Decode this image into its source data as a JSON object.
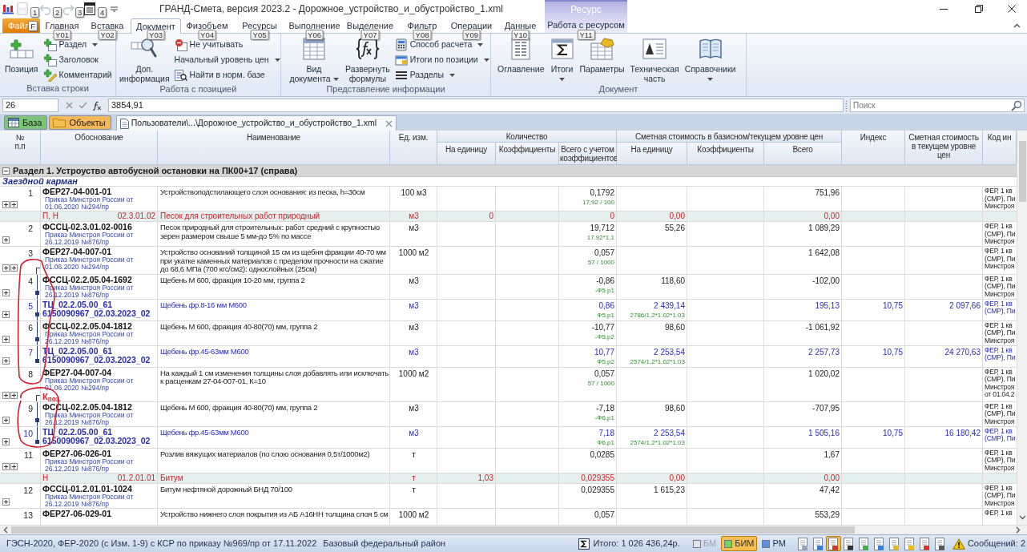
{
  "title_bar": {
    "title": "ГРАНД-Смета, версия 2023.2 - Дорожное_устройство_и_обустройство_1.xml",
    "quick_access": [
      {
        "keytip": "1",
        "disabled": true
      },
      {
        "keytip": "2",
        "disabled": true
      },
      {
        "keytip": "3",
        "disabled": true
      },
      {
        "keytip": "4",
        "disabled": false
      }
    ]
  },
  "ribbon": {
    "tabs": [
      {
        "kind": "file",
        "label": "Файл",
        "keytip": "F",
        "selected": false
      },
      {
        "kind": "normal",
        "label": "Главная",
        "keytip": "Y01",
        "selected": false
      },
      {
        "kind": "normal",
        "label": "Вставка",
        "keytip": "Y02",
        "selected": false
      },
      {
        "kind": "normal",
        "label": "Документ",
        "keytip": "Y03",
        "selected": true
      },
      {
        "kind": "normal",
        "label": "Физобъем",
        "keytip": "Y04",
        "selected": false
      },
      {
        "kind": "normal",
        "label": "Ресурсы",
        "keytip": "Y05",
        "selected": false
      },
      {
        "kind": "normal",
        "label": "Выполнение",
        "keytip": "Y06",
        "selected": false
      },
      {
        "kind": "normal",
        "label": "Выделение",
        "keytip": "Y07",
        "selected": false
      },
      {
        "kind": "normal",
        "label": "Фильтр",
        "keytip": "Y08",
        "selected": false
      },
      {
        "kind": "normal",
        "label": "Операции",
        "keytip": "Y09",
        "selected": false
      },
      {
        "kind": "normal",
        "label": "Данные",
        "keytip": "Y10",
        "selected": false
      },
      {
        "kind": "contextual",
        "label": "Работа с ресурсом",
        "keytip": "Y11",
        "selected": false
      }
    ],
    "contextual_group": "Ресурс",
    "groups": [
      {
        "label": "Вставка строки",
        "buttons": [
          {
            "kind": "large",
            "label": "Позиция",
            "dropdown": false
          },
          {
            "kind": "small",
            "label": "Раздел",
            "dropdown": true
          },
          {
            "kind": "small",
            "label": "Заголовок",
            "dropdown": false
          },
          {
            "kind": "small",
            "label": "Комментарий",
            "dropdown": false
          }
        ]
      },
      {
        "label": "Работа с позицией",
        "buttons": [
          {
            "kind": "large",
            "label": "Доп. информация",
            "dropdown": false
          },
          {
            "kind": "small",
            "label": "Не учитывать",
            "dropdown": false
          },
          {
            "kind": "small",
            "label": "Начальный уровень цен",
            "dropdown": true
          },
          {
            "kind": "small",
            "label": "Найти в норм. базе",
            "dropdown": false
          }
        ]
      },
      {
        "label": "Представление информации",
        "buttons": [
          {
            "kind": "large",
            "label": "Вид документа",
            "dropdown": true
          },
          {
            "kind": "large",
            "label": "Развернуть формулы",
            "dropdown": false
          },
          {
            "kind": "small",
            "label": "Способ расчета",
            "dropdown": true
          },
          {
            "kind": "small",
            "label": "Итоги по позиции",
            "dropdown": true
          },
          {
            "kind": "small",
            "label": "Разделы",
            "dropdown": true
          }
        ]
      },
      {
        "label": "Документ",
        "buttons": [
          {
            "kind": "large",
            "label": "Оглавление",
            "dropdown": false
          },
          {
            "kind": "large",
            "label": "Итоги",
            "dropdown": true
          },
          {
            "kind": "large",
            "label": "Параметры",
            "dropdown": false
          },
          {
            "kind": "large",
            "label": "Техническая часть",
            "dropdown": false
          },
          {
            "kind": "large",
            "label": "Справочники",
            "dropdown": true
          }
        ]
      }
    ]
  },
  "formula_bar": {
    "cell": "26",
    "value": "3854,91",
    "search_placeholder": "Поиск"
  },
  "document_tabs": {
    "buttons": [
      {
        "label": "База",
        "color": "#7cc47a"
      },
      {
        "label": "Объекты",
        "color": "#f6b65a"
      }
    ],
    "file_tab": "Пользователи\\...\\Дорожное_устройство_и_обустройство_1.xml"
  },
  "table": {
    "columns": [
      {
        "label": "№ п.п"
      },
      {
        "label": "Обоснование"
      },
      {
        "label": "Наименование"
      },
      {
        "label": "Ед. изм."
      },
      {
        "label": "Количество",
        "children": [
          "На единицу",
          "Коэффициенты",
          "Всего с учетом коэффициентов"
        ]
      },
      {
        "label": "Сметная стоимость в базисном/текущем уровне цен",
        "children": [
          "На единицу",
          "Коэффициенты",
          "Всего"
        ]
      },
      {
        "label": "Индекс"
      },
      {
        "label": "Сметная стоимость в текущем уровне цен"
      },
      {
        "label": "Код ин"
      }
    ],
    "section": {
      "title": "Раздел 1. Устроуство автобусной остановки на ПК00+17 (справа)",
      "expanded": true
    },
    "subsection": "Заездной карман",
    "rows": [
      {
        "kind": "position",
        "number": "1",
        "code": "ФЕР27-04-001-01",
        "order": "Приказ Минстроя России от 01.06.2020 №294/пр",
        "name": "Устройствоподстилающего слоя основания: из песка, h=30см",
        "unit": "100 м3",
        "quantity": "0,1792",
        "quantity_formula": "17,92 / 100",
        "total": "751,96",
        "code_info": [
          "ФЕР, 1 кв",
          "(СМР), Пи",
          "Минстроя"
        ],
        "expanders": [
          {
            "expanded": false
          },
          {
            "expanded": false
          }
        ],
        "linked_to_previous": false,
        "linked_to_next": false
      },
      {
        "kind": "resource",
        "type_code": "П, Н",
        "code": "02.3.01.02",
        "name": "Песок для строительных работ природный",
        "unit": "м3",
        "per_unit": "0",
        "quantity": "0",
        "unit_price": "0,00",
        "total": "0,00"
      },
      {
        "kind": "position",
        "number": "2",
        "code": "ФССЦ-02.3.01.02-0016",
        "order": "Приказ Минстроя России от 26.12.2019 №876/пр",
        "name": "Песок природный для строительных: работ средний с крупностью зерен размером свыше 5 мм-до 5% по массе",
        "unit": "м3",
        "quantity": "19,712",
        "quantity_formula": "17.92*1,1",
        "unit_price": "55,26",
        "total": "1 089,29",
        "code_info": [
          "ФЕР, 1 кв",
          "(СМР), Пи",
          "Минстроя"
        ],
        "expanders": [
          {
            "expanded": false
          }
        ],
        "linked_to_previous": false,
        "linked_to_next": false
      },
      {
        "kind": "position",
        "number": "3",
        "code": "ФЕР27-04-007-01",
        "order": "Приказ Минстроя России от 01.06.2020 №294/пр",
        "name": "Устройство оснований толщиной 15 см из щебня фракции 40-70 мм при укатке каменных материалов с пределом прочности на сжатие до 68,6 МПа (700 кгс/см2): однослойных (25см)",
        "unit": "1000 м2",
        "quantity": "0,057",
        "quantity_formula": "57 / 1000",
        "total": "1 642,08",
        "code_info": [
          "ФЕР, 1 кв",
          "(СМР), Пи",
          "Минстроя"
        ],
        "expanders": [
          {
            "expanded": false
          },
          {
            "expanded": false
          }
        ],
        "linked_to_previous": false,
        "linked_to_next": true
      },
      {
        "kind": "position",
        "number": "4",
        "code": "ФССЦ-02.2.05.04-1692",
        "order": "Приказ Минстроя России от 26.12.2019 №876/пр",
        "name": "Щебень М 600, фракция 10-20 мм, группа 2",
        "unit": "м3",
        "quantity": "-0,86",
        "quantity_formula": "-Ф5.р1",
        "unit_price": "118,60",
        "total": "-102,00",
        "code_info": [
          "ФЕР, 1 кв",
          "(СМР), Пи",
          "Минстроя"
        ],
        "expanders": [
          {
            "expanded": false
          }
        ],
        "linked_to_previous": true,
        "linked_to_next": true
      },
      {
        "kind": "tc",
        "number": "5",
        "code": "ТЦ_02.2.05.00_61 6150090967_02.03.2023_02",
        "name": "Щебень фр.8-16 мм М600",
        "unit": "м3",
        "quantity": "0,86",
        "quantity_formula": "Ф5.р1",
        "unit_price": "2 439,14",
        "price_formula": "2786/1,2*1.02*1.03",
        "total": "195,13",
        "index": "10,75",
        "current_total": "2 097,66",
        "code_info": [
          "ФЕР, 1 кв",
          "(СМР), Пи"
        ],
        "expanders": [
          {
            "expanded": false
          }
        ],
        "linked_to_previous": true,
        "linked_to_next": true
      },
      {
        "kind": "position",
        "number": "6",
        "code": "ФССЦ-02.2.05.04-1812",
        "order": "Приказ Минстроя России от 26.12.2019 №876/пр",
        "name": "Щебень М 600, фракция 40-80(70) мм, группа 2",
        "unit": "м3",
        "quantity": "-10,77",
        "quantity_formula": "-Ф5.р2",
        "unit_price": "98,60",
        "total": "-1 061,92",
        "code_info": [
          "ФЕР, 1 кв",
          "(СМР), Пи",
          "Минстроя"
        ],
        "expanders": [
          {
            "expanded": false
          }
        ],
        "linked_to_previous": true,
        "linked_to_next": true
      },
      {
        "kind": "tc",
        "number": "7",
        "code": "ТЦ_02.2.05.00_61 6150090967_02.03.2023_02",
        "name": "Щебень фр.45-63мм М600",
        "unit": "м3",
        "quantity": "10,77",
        "quantity_formula": "Ф5.р2",
        "unit_price": "2 253,54",
        "price_formula": "2574/1,2*1.02*1.03",
        "total": "2 257,73",
        "index": "10,75",
        "current_total": "24 270,63",
        "code_info": [
          "ФЕР, 1 кв",
          "(СМР), Пи"
        ],
        "expanders": [
          {
            "expanded": false
          }
        ],
        "linked_to_previous": true,
        "linked_to_next": false
      },
      {
        "kind": "position",
        "number": "8",
        "code": "ФЕР27-04-007-04",
        "order": "Приказ Минстроя России от 01.06.2020 №294/пр",
        "marker": "К$_{поз.}$",
        "name": "На каждый 1 см изменения толщины слоя добавлять или исключать к расценкам 27-04-007-01, К=10",
        "unit": "1000 м2",
        "quantity": "0,057",
        "quantity_formula": "57 / 1000",
        "total": "1 020,02",
        "code_info": [
          "ФЕР, 1 кв",
          "(СМР), Пи",
          "Минстроя",
          "от 01.04.2"
        ],
        "expanders": [
          {
            "expanded": false
          },
          {
            "expanded": false
          }
        ],
        "linked_to_previous": false,
        "linked_to_next": true
      },
      {
        "kind": "position",
        "number": "9",
        "code": "ФССЦ-02.2.05.04-1812",
        "order": "Приказ Минстроя России от 26.12.2019 №876/пр",
        "name": "Щебень М 600, фракция 40-80(70) мм, группа 2",
        "unit": "м3",
        "quantity": "-7,18",
        "quantity_formula": "-Ф6.р1",
        "unit_price": "98,60",
        "total": "-707,95",
        "code_info": [
          "ФЕР, 1 кв",
          "(СМР), Пи",
          "Минстроя"
        ],
        "expanders": [
          {
            "expanded": false
          }
        ],
        "linked_to_previous": true,
        "linked_to_next": true
      },
      {
        "kind": "tc",
        "number": "10",
        "code": "ТЦ_02.2.05.00_61 6150090967_02.03.2023_02",
        "name": "Щебень фр.45-63мм М600",
        "unit": "м3",
        "quantity": "7,18",
        "quantity_formula": "Ф6.р1",
        "unit_price": "2 253,54",
        "price_formula": "2574/1.2*1.02*1.03",
        "total": "1 505,16",
        "index": "10,75",
        "current_total": "16 180,42",
        "code_info": [
          "ФЕР, 1 кв",
          "(СМР), Пи"
        ],
        "expanders": [
          {
            "expanded": false
          }
        ],
        "linked_to_previous": true,
        "linked_to_next": false
      },
      {
        "kind": "position",
        "number": "11",
        "code": "ФЕР27-06-026-01",
        "order": "Приказ Минстроя России от 26.12.2019 №876/пр",
        "name": "Розлив вяжущих материалов (по слою основания 0,5т/1000м2)",
        "unit": "т",
        "quantity": "0,0285",
        "total": "1,67",
        "code_info": [
          "ФЕР, 1 кв",
          "(СМР), Пи",
          "Минстроя"
        ],
        "expanders": [
          {
            "expanded": false
          },
          {
            "expanded": false
          }
        ],
        "linked_to_previous": false,
        "linked_to_next": false
      },
      {
        "kind": "resource",
        "type_code": "Н",
        "code": "01.2.01.01",
        "name": "Битум",
        "unit": "т",
        "per_unit": "1,03",
        "quantity": "0,029355",
        "unit_price": "0,00",
        "total": "0,00"
      },
      {
        "kind": "position",
        "number": "12",
        "code": "ФССЦ-01.2.01.01-1024",
        "order": "Приказ Минстроя России от 26.12.2019 №876/пр",
        "name": "Битум нефтяной дорожный БНД 70/100",
        "unit": "т",
        "quantity": "0,029355",
        "unit_price": "1 615,23",
        "total": "47,42",
        "code_info": [
          "ФЕР, 1 кв",
          "(СМР), Пи",
          "Минстроя"
        ],
        "expanders": [
          {
            "expanded": false
          }
        ],
        "linked_to_previous": false,
        "linked_to_next": false
      },
      {
        "kind": "position",
        "number": "13",
        "code": "ФЕР27-06-029-01",
        "name": "Устройство нижнего слоя покрытия из АБ А16НН толщина слоя 5 см",
        "unit": "1000 м2",
        "quantity": "0,057",
        "total": "553,29",
        "code_info": [
          "ФЕР, 1 кв"
        ],
        "linked_to_previous": false,
        "linked_to_next": false
      }
    ]
  },
  "status_bar": {
    "norms": "ГЭСН-2020, ФЕР-2020 (с Изм. 1-9) с КСР по приказу №969/пр от 17.11.2022",
    "region": "Базовый федеральный район",
    "total": "Итого: 1 026 436,24р.",
    "modes": [
      {
        "label": "БМ",
        "color": "#e4e4e4",
        "selected": false,
        "disabled": true
      },
      {
        "label": "БИМ",
        "color": "#72d35c",
        "selected": true,
        "disabled": false
      },
      {
        "label": "РМ",
        "color": "#5b8fe0",
        "selected": false,
        "disabled": false
      }
    ],
    "view_buttons": [
      {
        "selected": false
      },
      {
        "selected": false
      },
      {
        "selected": true
      },
      {
        "selected": false
      },
      {
        "selected": false
      },
      {
        "selected": false
      },
      {
        "selected": false
      },
      {
        "selected": false
      },
      {
        "selected": false
      },
      {
        "selected": false
      }
    ],
    "messages": "Сообщений: 2"
  }
}
